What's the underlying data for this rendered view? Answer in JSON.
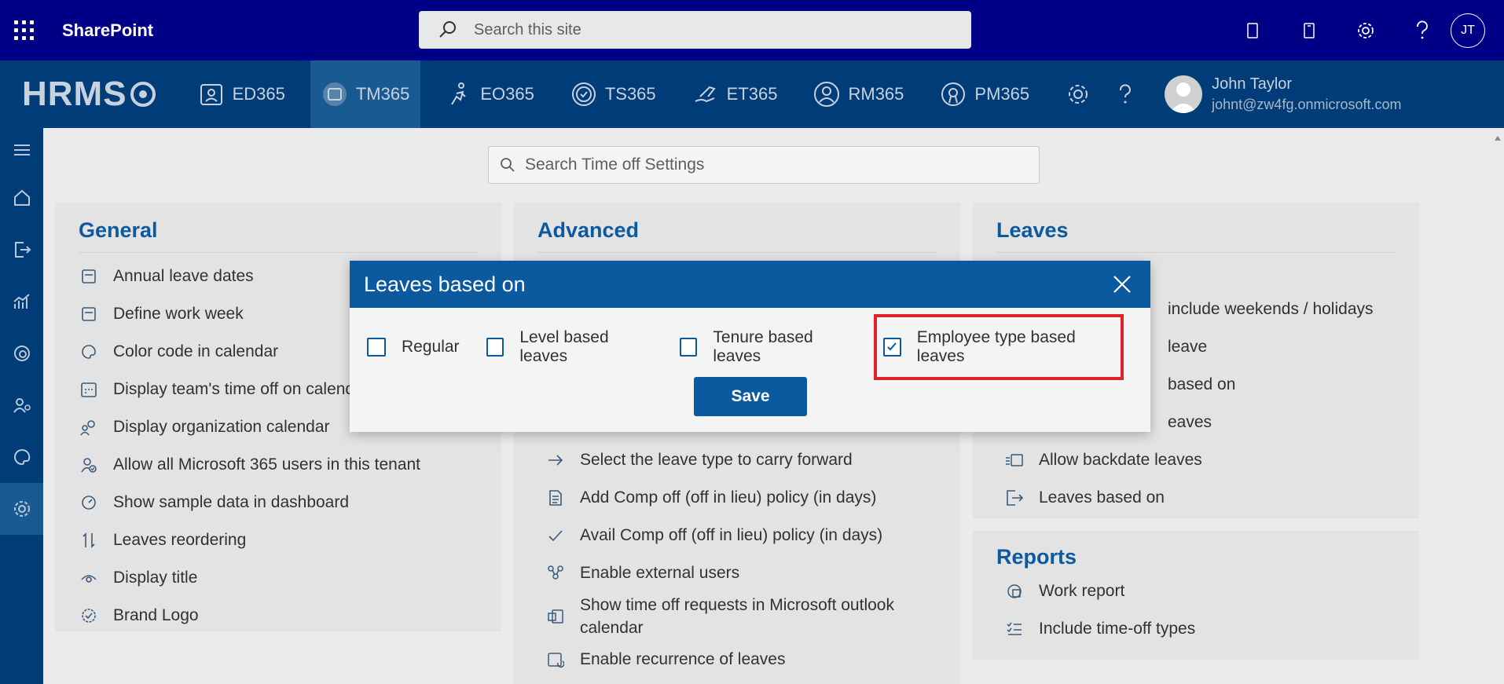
{
  "suitebar": {
    "title": "SharePoint",
    "search_placeholder": "Search this site",
    "avatar_initials": "JT"
  },
  "appbar": {
    "logo": "HRMS",
    "tabs": [
      {
        "label": "ED365",
        "icon": "id-badge-icon"
      },
      {
        "label": "TM365",
        "icon": "calendar-icon",
        "active": true
      },
      {
        "label": "EO365",
        "icon": "run-icon"
      },
      {
        "label": "TS365",
        "icon": "clock-icon"
      },
      {
        "label": "ET365",
        "icon": "hand-money-icon"
      },
      {
        "label": "RM365",
        "icon": "person-icon"
      },
      {
        "label": "PM365",
        "icon": "award-icon"
      }
    ],
    "user": {
      "name": "John Taylor",
      "email": "johnt@zw4fg.onmicrosoft.com"
    }
  },
  "content": {
    "search_placeholder": "Search Time off Settings",
    "general": {
      "title": "General",
      "items": [
        "Annual leave dates",
        "Define work week",
        "Color code in calendar",
        "Display team's time off on calendar",
        "Display organization calendar",
        "Allow all Microsoft 365 users in this tenant",
        "Show sample data in dashboard",
        "Leaves reordering",
        "Display title",
        "Brand Logo"
      ]
    },
    "advanced": {
      "title": "Advanced",
      "items": [
        "Select the leave type to carry forward",
        "Add Comp off (off in lieu) policy (in days)",
        "Avail Comp off (off in lieu) policy (in days)",
        "Enable external users",
        "Show time off requests in Microsoft outlook calendar",
        "Enable recurrence of leaves"
      ]
    },
    "leaves": {
      "title": "Leaves",
      "items": [
        "include weekends / holidays",
        "leave",
        "based on",
        "eaves",
        "Allow backdate leaves",
        "Leaves based on"
      ]
    },
    "reports": {
      "title": "Reports",
      "items": [
        "Work report",
        "Include time-off types"
      ]
    }
  },
  "dialog": {
    "title": "Leaves based on",
    "options": [
      {
        "label": "Regular",
        "checked": false
      },
      {
        "label": "Level based leaves",
        "checked": false
      },
      {
        "label": "Tenure based leaves",
        "checked": false
      },
      {
        "label": "Employee type based leaves",
        "checked": true,
        "highlighted": true
      }
    ],
    "save_label": "Save"
  },
  "colors": {
    "suitebar": "#000087",
    "appbar": "#003c78",
    "accent": "#0b5aa0",
    "highlight_border": "#e0222b"
  }
}
